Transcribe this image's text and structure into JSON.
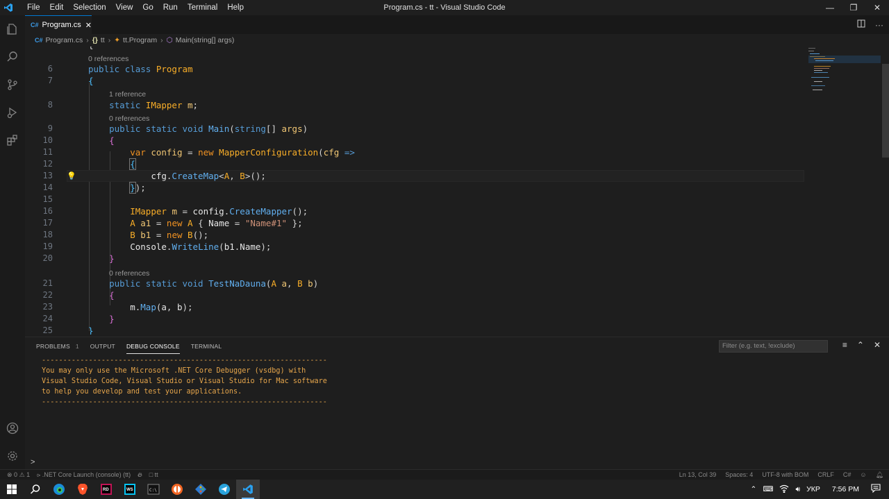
{
  "window": {
    "title": "Program.cs - tt - Visual Studio Code",
    "menu": [
      "File",
      "Edit",
      "Selection",
      "View",
      "Go",
      "Run",
      "Terminal",
      "Help"
    ],
    "controls": [
      "minimize",
      "restore",
      "close"
    ]
  },
  "activity_bar": [
    "explorer-icon",
    "search-icon",
    "source-control-icon",
    "run-debug-icon",
    "extensions-icon",
    "account-icon",
    "settings-gear-icon"
  ],
  "tabs": [
    {
      "icon": "C#",
      "label": "Program.cs",
      "active": true
    }
  ],
  "breadcrumb": {
    "file_icon": "C#",
    "file": "Program.cs",
    "ns_icon": "{}",
    "namespace": "tt",
    "class": "tt.Program",
    "method": "Main(string[] args)"
  },
  "editor": {
    "codelens": {
      "l6": "0 references",
      "l8": "1 reference",
      "l9": "0 references",
      "l21": "0 references"
    },
    "line_numbers": [
      "6",
      "7",
      "8",
      "9",
      "10",
      "11",
      "12",
      "13",
      "14",
      "15",
      "16",
      "17",
      "18",
      "19",
      "20",
      "21",
      "22",
      "23",
      "24",
      "25"
    ],
    "partial_first_line": "{"
  },
  "panel": {
    "tabs": [
      "PROBLEMS",
      "OUTPUT",
      "DEBUG CONSOLE",
      "TERMINAL"
    ],
    "problems_count": "1",
    "active_tab": "DEBUG CONSOLE",
    "filter_placeholder": "Filter (e.g. text, !exclude)",
    "console_lines": [
      "-------------------------------------------------------------------",
      "You may only use the Microsoft .NET Core Debugger (vsdbg) with",
      "Visual Studio Code, Visual Studio or Visual Studio for Mac software",
      "to help you develop and test your applications.",
      "-------------------------------------------------------------------"
    ],
    "prompt": ">"
  },
  "status_bar": {
    "errors": "0",
    "warnings": "1",
    "launch": ".NET Core Launch (console) (tt)",
    "folder": "tt",
    "position": "Ln 13, Col 39",
    "spaces": "Spaces: 4",
    "encoding": "UTF-8 with BOM",
    "eol": "CRLF",
    "language": "C#"
  },
  "taskbar": {
    "apps": [
      "start-icon",
      "search-icon",
      "edge-icon",
      "brave-icon",
      "rider-icon",
      "webstorm-icon",
      "terminal-icon",
      "chrome-like-icon",
      "git-icon",
      "telegram-icon",
      "vscode-icon"
    ],
    "language": "УКР",
    "time": "7:56 PM"
  },
  "colors": {
    "accent": "#0078d4",
    "keyword": "#569cd6",
    "keyword_control": "#f19222",
    "type": "#f9ae28",
    "method": "#61afef",
    "string": "#ce9178",
    "console_text": "#e5a54b"
  }
}
